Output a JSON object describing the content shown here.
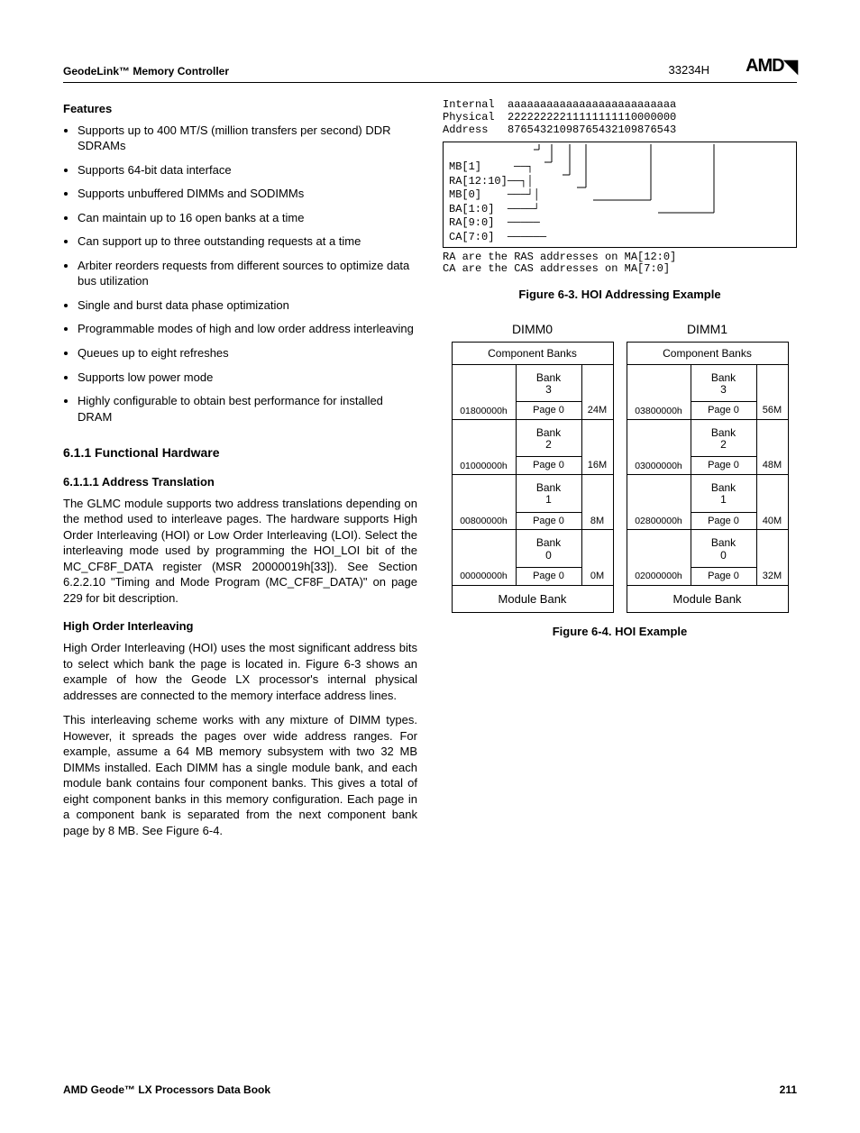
{
  "header": {
    "left": "GeodeLink™ Memory Controller",
    "right_code": "33234H",
    "logo": "AMD"
  },
  "features_title": "Features",
  "features": [
    "Supports up to 400 MT/S (million transfers per second) DDR SDRAMs",
    "Supports 64-bit data interface",
    "Supports unbuffered DIMMs and SODIMMs",
    "Can maintain up to 16 open banks at a time",
    "Can support up to three outstanding requests at a time",
    "Arbiter reorders requests from different sources to optimize data bus utilization",
    "Single and burst data phase optimization",
    "Programmable modes of high and low order address interleaving",
    "Queues up to eight refreshes",
    "Supports low power mode",
    "Highly configurable to obtain best performance for installed DRAM"
  ],
  "h611": "6.1.1      Functional Hardware",
  "h6111": "6.1.1.1    Address Translation",
  "p_addr": "The GLMC module supports two address translations depending on the method used to interleave pages. The hardware supports High Order Interleaving (HOI) or Low Order Interleaving (LOI). Select the interleaving mode used by programming the HOI_LOI bit of the MC_CF8F_DATA register (MSR 20000019h[33]). See Section 6.2.2.10 \"Timing and Mode Program (MC_CF8F_DATA)\" on page 229 for bit description.",
  "h_hoi": "High Order Interleaving",
  "p_hoi1": "High Order Interleaving (HOI) uses the most significant address bits to select which bank the page is located in. Figure 6-3 shows an example of how the Geode LX processor's internal physical addresses are connected to the memory interface address lines.",
  "p_hoi2": "This interleaving scheme works with any mixture of DIMM types. However, it spreads the pages over wide address ranges. For example, assume a 64 MB memory subsystem with two 32 MB DIMMs installed. Each DIMM has a single module bank, and each module bank contains four component banks. This gives a total of eight component banks in this memory configuration. Each page in a component bank is separated from the next component bank page by 8 MB. See Figure 6-4.",
  "fig63": {
    "top_l1": "Internal",
    "top_l2": "Physical",
    "top_l3": "Address",
    "a_row": "aaaaaaaaaaaaaaaaaaaaaaaaaa",
    "n_row1": "22222222211111111110000000",
    "n_row2": "87654321098765432109876543",
    "sig": [
      "MB[1]",
      "RA[12:10]",
      "MB[0]",
      "BA[1:0]",
      "RA[9:0]",
      "CA[7:0]"
    ],
    "note1": "RA are the RAS addresses on MA[12:0]",
    "note2": "CA are the CAS addresses on MA[7:0]",
    "caption": "Figure 6-3.  HOI Addressing Example"
  },
  "fig64": {
    "dimms": [
      {
        "title": "DIMM0",
        "cb": "Component Banks",
        "rows": [
          {
            "addr": "01800000h",
            "bank": "Bank\n3",
            "page": "Page 0",
            "size": "24M"
          },
          {
            "addr": "01000000h",
            "bank": "Bank\n2",
            "page": "Page 0",
            "size": "16M"
          },
          {
            "addr": "00800000h",
            "bank": "Bank\n1",
            "page": "Page 0",
            "size": "8M"
          },
          {
            "addr": "00000000h",
            "bank": "Bank\n0",
            "page": "Page 0",
            "size": "0M"
          }
        ],
        "mb": "Module Bank"
      },
      {
        "title": "DIMM1",
        "cb": "Component Banks",
        "rows": [
          {
            "addr": "03800000h",
            "bank": "Bank\n3",
            "page": "Page 0",
            "size": "56M"
          },
          {
            "addr": "03000000h",
            "bank": "Bank\n2",
            "page": "Page 0",
            "size": "48M"
          },
          {
            "addr": "02800000h",
            "bank": "Bank\n1",
            "page": "Page 0",
            "size": "40M"
          },
          {
            "addr": "02000000h",
            "bank": "Bank\n0",
            "page": "Page 0",
            "size": "32M"
          }
        ],
        "mb": "Module Bank"
      }
    ],
    "caption": "Figure 6-4.  HOI Example"
  },
  "footer": {
    "left": "AMD Geode™ LX Processors Data Book",
    "right": "211"
  }
}
